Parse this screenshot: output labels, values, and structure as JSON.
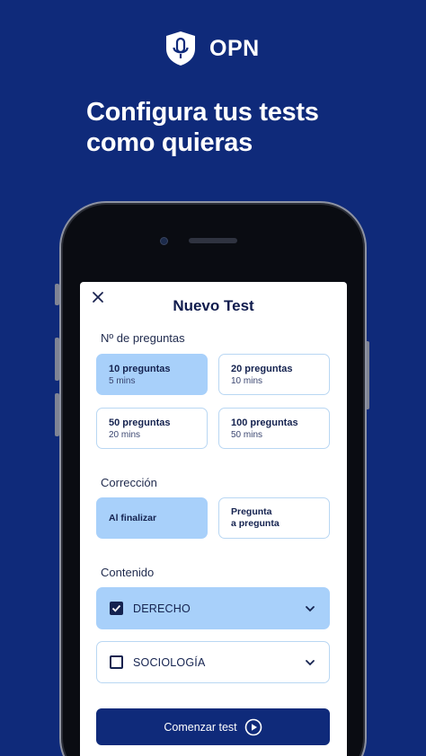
{
  "brand": {
    "name": "OPN",
    "logo_icon": "shield-microphone-icon"
  },
  "headline": {
    "line1": "Configura tus tests",
    "line2": "como quieras"
  },
  "screen": {
    "title": "Nuevo Test",
    "close_icon": "close-icon",
    "questions": {
      "label": "Nº de preguntas",
      "options": [
        {
          "title": "10 preguntas",
          "subtitle": "5 mins",
          "selected": true
        },
        {
          "title": "20 preguntas",
          "subtitle": "10 mins",
          "selected": false
        },
        {
          "title": "50 preguntas",
          "subtitle": "20 mins",
          "selected": false
        },
        {
          "title": "100 preguntas",
          "subtitle": "50 mins",
          "selected": false
        }
      ]
    },
    "correction": {
      "label": "Corrección",
      "options": [
        {
          "title": "Al finalizar",
          "selected": true
        },
        {
          "title_line1": "Pregunta",
          "title_line2": "a pregunta",
          "selected": false
        }
      ]
    },
    "content": {
      "label": "Contenido",
      "items": [
        {
          "label": "DERECHO",
          "checked": true
        },
        {
          "label": "SOCIOLOGÍA",
          "checked": false
        }
      ]
    },
    "start_button": {
      "label": "Comenzar test",
      "icon": "play-circle-icon"
    }
  },
  "colors": {
    "background": "#0f2a7a",
    "selected": "#a8d0fa",
    "border": "#b9d7f3",
    "text_dark": "#14224f"
  }
}
